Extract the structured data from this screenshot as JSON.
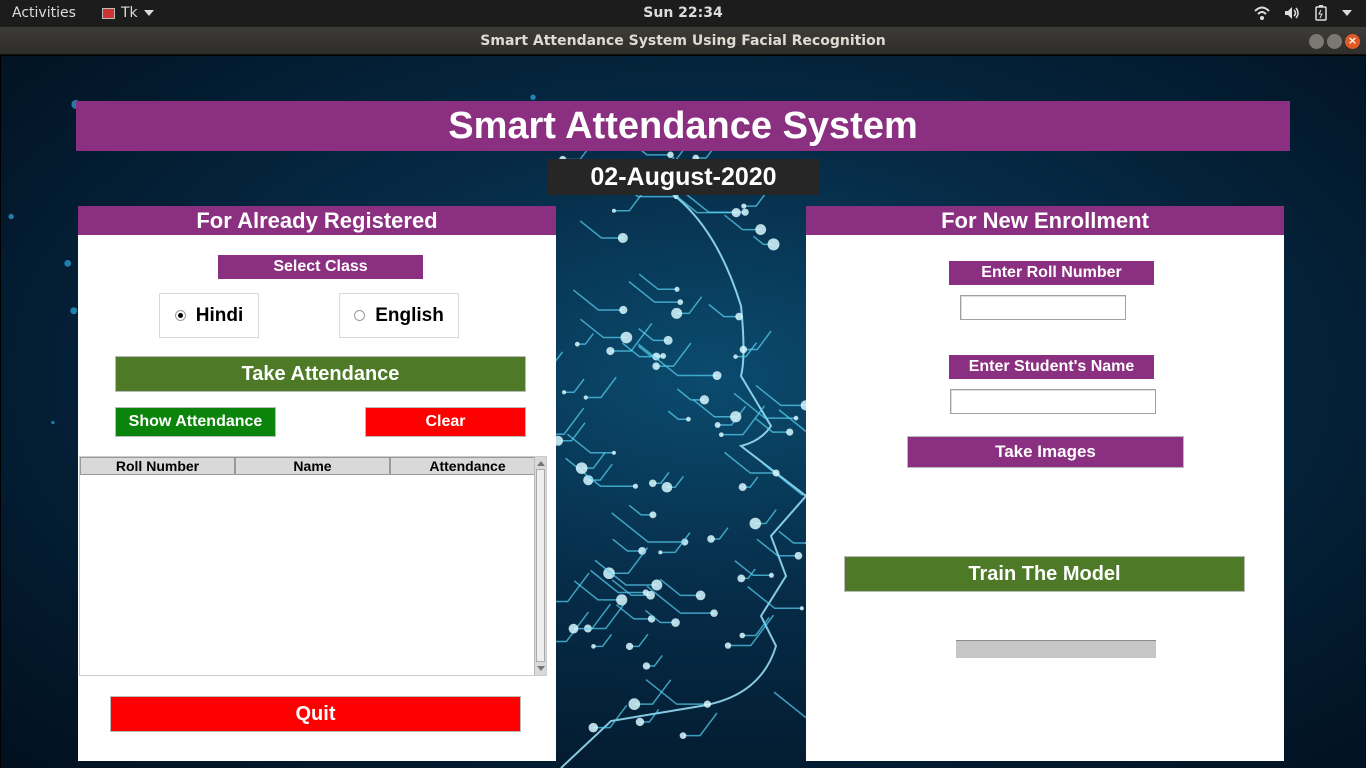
{
  "system_bar": {
    "activities": "Activities",
    "app_menu": "Tk",
    "clock": "Sun 22:34"
  },
  "window": {
    "title": "Smart Attendance System Using Facial Recognition",
    "close_glyph": "×"
  },
  "app": {
    "title": "Smart Attendance System",
    "date": "02-August-2020"
  },
  "registered_panel": {
    "header": "For Already Registered",
    "select_class_label": "Select Class",
    "radio_options": [
      {
        "label": "Hindi",
        "selected": true
      },
      {
        "label": "English",
        "selected": false
      }
    ],
    "take_attendance_label": "Take Attendance",
    "show_attendance_label": "Show Attendance",
    "clear_label": "Clear",
    "table_columns": [
      "Roll Number",
      "Name",
      "Attendance"
    ],
    "table_rows": [],
    "quit_label": "Quit"
  },
  "enrollment_panel": {
    "header": "For New Enrollment",
    "roll_label": "Enter Roll Number",
    "roll_value": "",
    "name_label": "Enter Student's Name",
    "name_value": "",
    "take_images_label": "Take Images",
    "train_model_label": "Train The Model",
    "status_text": ""
  },
  "colors": {
    "accent_purple": "#8b2f80",
    "green_button": "#4e7a28",
    "bright_green_button": "#0a840a",
    "red_button": "#ff0000",
    "date_background": "#262626"
  },
  "icons": [
    "tk-window-icon",
    "chevron-down-icon",
    "wifi-icon",
    "volume-icon",
    "battery-icon",
    "power-menu-icon",
    "minimize-icon",
    "maximize-icon",
    "close-icon"
  ]
}
